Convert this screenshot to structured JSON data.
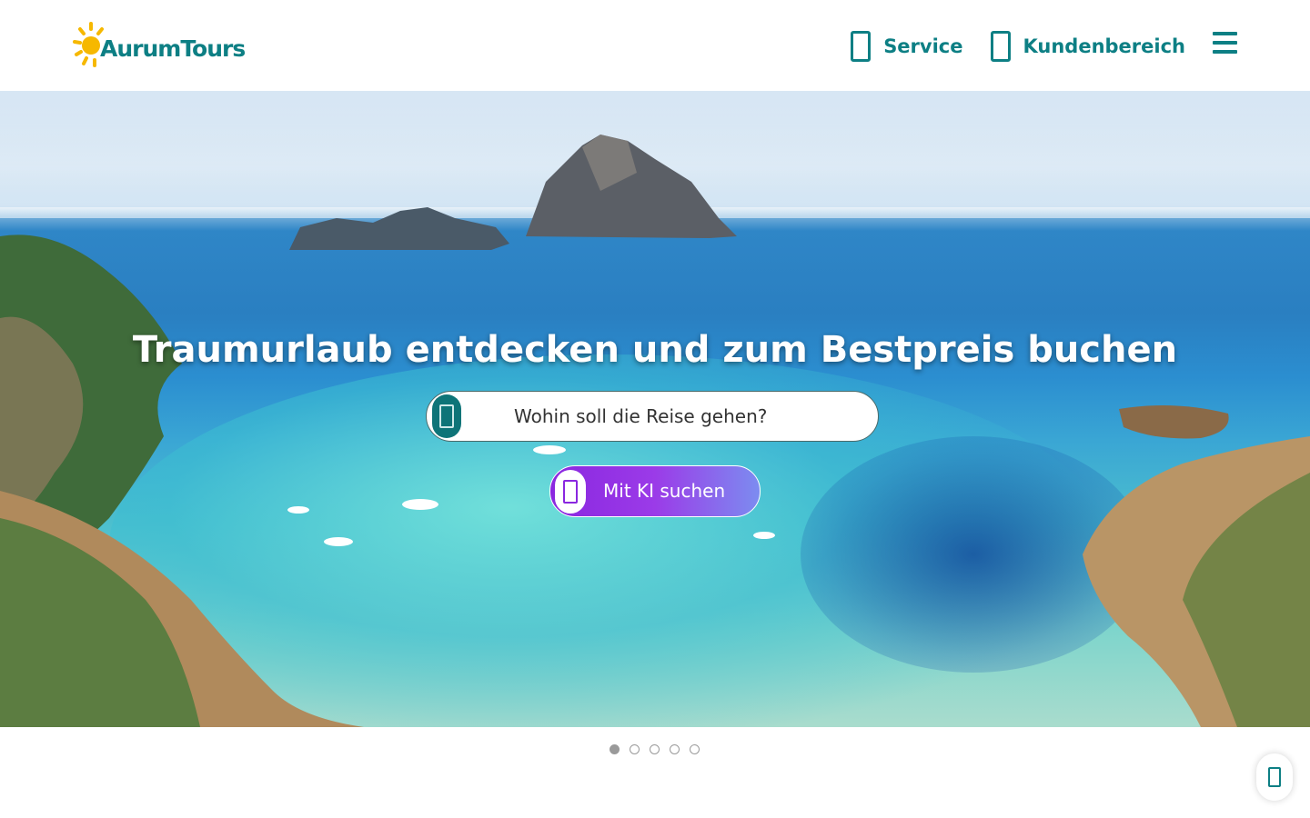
{
  "brand": {
    "name": "AurumTours",
    "accent": "#0d7f84",
    "sun_color": "#f6b800"
  },
  "header": {
    "nav": [
      {
        "label": "Service",
        "icon": "service-icon"
      },
      {
        "label": "Kundenbereich",
        "icon": "user-icon"
      }
    ],
    "menu_icon": "hamburger-menu-icon"
  },
  "hero": {
    "title": "Traumurlaub entdecken und zum Bestpreis buchen",
    "search": {
      "placeholder": "Wohin soll die Reise gehen?",
      "icon": "search-icon"
    },
    "ai_button": {
      "label": "Mit KI suchen",
      "icon": "ai-sparkle-icon",
      "gradient_start": "#8a27e0",
      "gradient_end": "#7c8cf0"
    },
    "image": "coastal bay with turquoise water, rocky islands and sailboats"
  },
  "carousel": {
    "slide_count": 5,
    "active_index": 0
  },
  "floating_button": {
    "icon": "chat-icon"
  }
}
